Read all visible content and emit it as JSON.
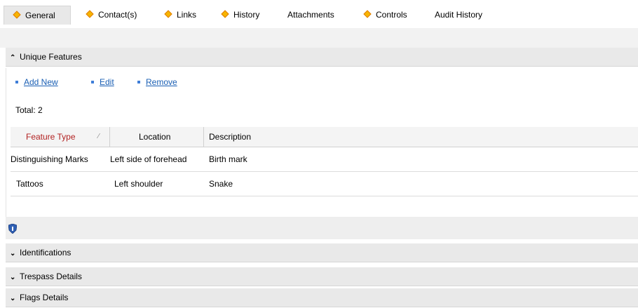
{
  "tabs": [
    {
      "label": "General",
      "has_icon": true
    },
    {
      "label": "Contact(s)",
      "has_icon": true
    },
    {
      "label": "Links",
      "has_icon": true
    },
    {
      "label": "History",
      "has_icon": true
    },
    {
      "label": "Attachments",
      "has_icon": false
    },
    {
      "label": "Controls",
      "has_icon": true
    },
    {
      "label": "Audit History",
      "has_icon": false
    }
  ],
  "unique_features": {
    "title": "Unique Features",
    "actions": {
      "add": "Add New",
      "edit": "Edit",
      "remove": "Remove"
    },
    "total": "Total: 2",
    "columns": [
      "Feature Type",
      "Location",
      "Description"
    ],
    "rows": [
      [
        "Distinguishing Marks",
        "Left side of forehead",
        "Birth mark"
      ],
      [
        "Tattoos",
        "Left shoulder",
        "Snake"
      ]
    ]
  },
  "sections": [
    {
      "title": "Identifications"
    },
    {
      "title": "Trespass Details"
    },
    {
      "title": "Flags Details"
    }
  ],
  "colors": {
    "accent_text": "#b22222",
    "link": "#1a5fb4",
    "diamond": "#f7b500"
  }
}
